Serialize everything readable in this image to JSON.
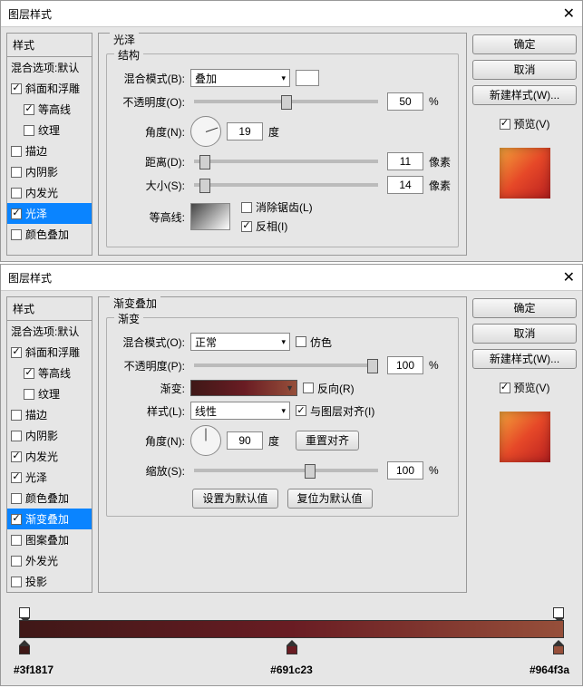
{
  "dialogs": [
    {
      "title": "图层样式",
      "sidebar": {
        "header": "样式",
        "blend_row": "混合选项:默认",
        "items": [
          {
            "label": "斜面和浮雕",
            "checked": true,
            "indent": false
          },
          {
            "label": "等高线",
            "checked": true,
            "indent": true
          },
          {
            "label": "纹理",
            "checked": false,
            "indent": true
          },
          {
            "label": "描边",
            "checked": false,
            "indent": false
          },
          {
            "label": "内阴影",
            "checked": false,
            "indent": false
          },
          {
            "label": "内发光",
            "checked": false,
            "indent": false
          },
          {
            "label": "光泽",
            "checked": true,
            "indent": false,
            "selected": true
          },
          {
            "label": "颜色叠加",
            "checked": false,
            "indent": false
          }
        ]
      },
      "panel": {
        "title": "光泽",
        "group": "结构",
        "blend_mode_label": "混合模式(B):",
        "blend_mode_value": "叠加",
        "opacity_label": "不透明度(O):",
        "opacity_value": "50",
        "opacity_unit": "%",
        "angle_label": "角度(N):",
        "angle_value": "19",
        "angle_unit": "度",
        "distance_label": "距离(D):",
        "distance_value": "11",
        "distance_unit": "像素",
        "size_label": "大小(S):",
        "size_value": "14",
        "size_unit": "像素",
        "contour_label": "等高线:",
        "antialias_label": "消除锯齿(L)",
        "invert_label": "反相(I)",
        "invert_checked": true
      },
      "buttons": {
        "ok": "确定",
        "cancel": "取消",
        "new_style": "新建样式(W)...",
        "preview": "预览(V)"
      }
    },
    {
      "title": "图层样式",
      "sidebar": {
        "header": "样式",
        "blend_row": "混合选项:默认",
        "items": [
          {
            "label": "斜面和浮雕",
            "checked": true,
            "indent": false
          },
          {
            "label": "等高线",
            "checked": true,
            "indent": true
          },
          {
            "label": "纹理",
            "checked": false,
            "indent": true
          },
          {
            "label": "描边",
            "checked": false,
            "indent": false
          },
          {
            "label": "内阴影",
            "checked": false,
            "indent": false
          },
          {
            "label": "内发光",
            "checked": true,
            "indent": false
          },
          {
            "label": "光泽",
            "checked": true,
            "indent": false
          },
          {
            "label": "颜色叠加",
            "checked": false,
            "indent": false
          },
          {
            "label": "渐变叠加",
            "checked": true,
            "indent": false,
            "selected": true
          },
          {
            "label": "图案叠加",
            "checked": false,
            "indent": false
          },
          {
            "label": "外发光",
            "checked": false,
            "indent": false
          },
          {
            "label": "投影",
            "checked": false,
            "indent": false
          }
        ]
      },
      "panel": {
        "title": "渐变叠加",
        "group": "渐变",
        "blend_mode_label": "混合模式(O):",
        "blend_mode_value": "正常",
        "dither_label": "仿色",
        "opacity_label": "不透明度(P):",
        "opacity_value": "100",
        "opacity_unit": "%",
        "gradient_label": "渐变:",
        "reverse_label": "反向(R)",
        "style_label": "样式(L):",
        "style_value": "线性",
        "align_label": "与图层对齐(I)",
        "align_checked": true,
        "angle_label": "角度(N):",
        "angle_value": "90",
        "angle_unit": "度",
        "reset_align": "重置对齐",
        "scale_label": "缩放(S):",
        "scale_value": "100",
        "scale_unit": "%",
        "make_default": "设置为默认值",
        "reset_default": "复位为默认值"
      },
      "buttons": {
        "ok": "确定",
        "cancel": "取消",
        "new_style": "新建样式(W)...",
        "preview": "预览(V)"
      },
      "gradient": {
        "stops": [
          {
            "pos": "2%",
            "color": "#3f1817",
            "label": "#3f1817"
          },
          {
            "pos": "50%",
            "color": "#691c23",
            "label": "#691c23"
          },
          {
            "pos": "98%",
            "color": "#964f3a",
            "label": "#964f3a"
          }
        ]
      }
    }
  ]
}
